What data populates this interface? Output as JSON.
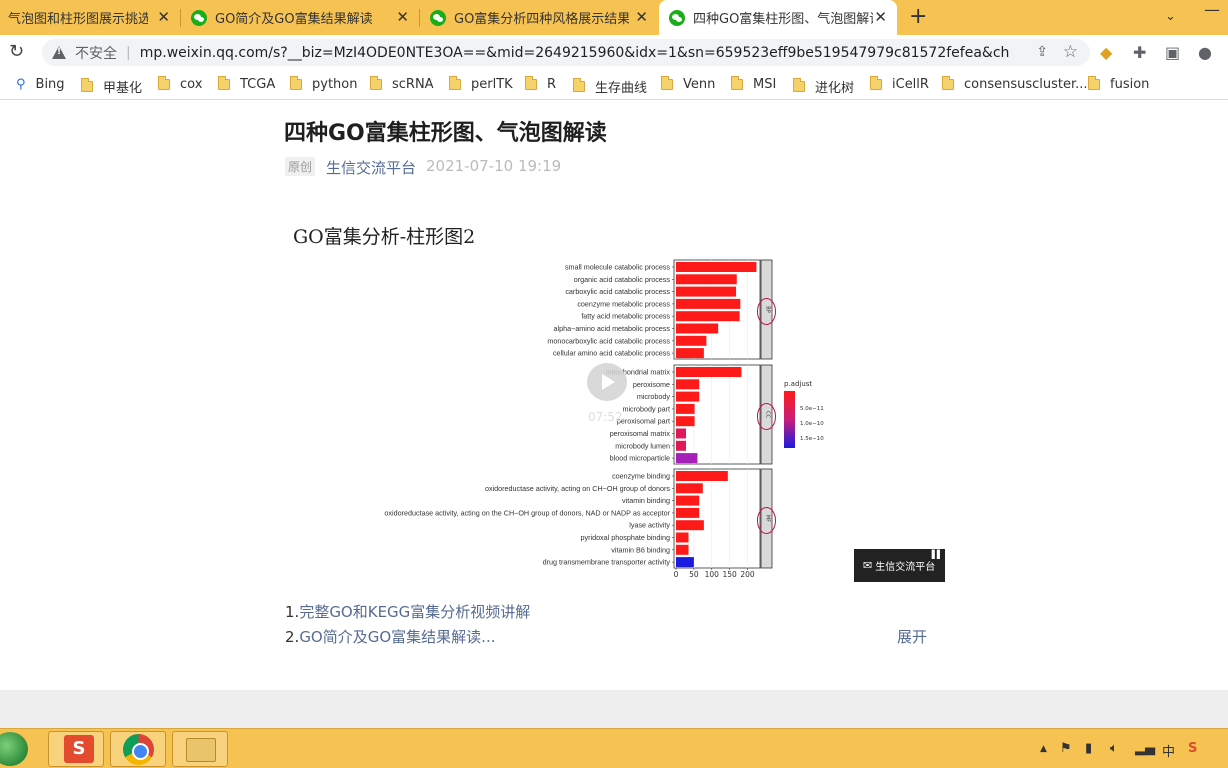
{
  "tabs": [
    {
      "title": "气泡图和柱形图展示挑选的"
    },
    {
      "title": "GO简介及GO富集结果解读"
    },
    {
      "title": "GO富集分析四种风格展示结果—"
    },
    {
      "title": "四种GO富集柱形图、气泡图解读"
    }
  ],
  "tab_close": "✕",
  "new_tab": "+",
  "tab_list": "⌄",
  "minimize": "—",
  "omnibox": {
    "insecure": "不安全",
    "sep": "|",
    "url": "mp.weixin.qq.com/s?__biz=MzI4ODE0NTE3OA==&mid=2649215960&idx=1&sn=659523eff9be519547979c81572fefea&chksm=f..."
  },
  "bookmarks": [
    "Bing",
    "甲基化",
    "cox",
    "TCGA",
    "python",
    "scRNA",
    "perlTK",
    "R",
    "生存曲线",
    "Venn",
    "MSI",
    "进化树",
    "iCellR",
    "consensuscluster...",
    "fusion"
  ],
  "article": {
    "title": "四种GO富集柱形图、气泡图解读",
    "badge": "原创",
    "author": "生信交流平台",
    "date": "2021-07-10 19:19",
    "video_heading": "GO富集分析-柱形图2",
    "video_time": "07:52",
    "watermark": "生信交流平台",
    "link1_num": "1.",
    "link1": "完整GO和KEGG富集分析视频讲解",
    "link2_num": "2.",
    "link2": "GO简介及GO富集结果解读...",
    "expand": "展开"
  },
  "chart_data": {
    "type": "bar",
    "orientation": "horizontal",
    "facets": [
      {
        "name": "BP",
        "categories": [
          "small molecule catabolic process",
          "organic acid catabolic process",
          "carboxylic acid catabolic process",
          "coenzyme metabolic process",
          "fatty acid metabolic process",
          "alpha−amino acid metabolic process",
          "monocarboxylic acid catabolic process",
          "cellular amino acid catabolic process"
        ],
        "values": [
          225,
          170,
          168,
          180,
          178,
          118,
          85,
          78
        ],
        "colors": [
          "#ff1a1a",
          "#ff1a1a",
          "#ff1a1a",
          "#ff1a1a",
          "#ff1a1a",
          "#ff1a1a",
          "#ff1a1a",
          "#ff1a1a"
        ]
      },
      {
        "name": "CC",
        "categories": [
          "mitochondrial matrix",
          "peroxisome",
          "microbody",
          "microbody part",
          "peroxisomal part",
          "peroxisomal matrix",
          "microbody lumen",
          "blood microparticle"
        ],
        "values": [
          183,
          65,
          65,
          52,
          52,
          28,
          28,
          60
        ],
        "colors": [
          "#ff1a1a",
          "#ff1a1a",
          "#ff1a1a",
          "#ff1a1a",
          "#ff1a1a",
          "#e0185a",
          "#e0185a",
          "#a51fb8"
        ]
      },
      {
        "name": "MF",
        "categories": [
          "coenzyme binding",
          "oxidoreductase activity, acting on CH−OH group of donors",
          "vitamin binding",
          "oxidoreductase activity, acting on the CH−OH group of donors, NAD or NADP as acceptor",
          "lyase activity",
          "pyridoxal phosphate binding",
          "vitamin B6 binding",
          "drug transmembrane transporter activity"
        ],
        "values": [
          145,
          75,
          65,
          65,
          78,
          35,
          35,
          50
        ],
        "colors": [
          "#ff1a1a",
          "#ff1a1a",
          "#ff1a1a",
          "#ff1a1a",
          "#ff1a1a",
          "#ff1a1a",
          "#ff1a1a",
          "#1a1ae0"
        ]
      }
    ],
    "x_ticks": [
      0,
      50,
      100,
      150,
      200
    ],
    "xlim": [
      0,
      235
    ],
    "legend": {
      "title": "p.adjust",
      "labels": [
        "5.0e−11",
        "1.0e−10",
        "1.5e−10"
      ],
      "colors": [
        "#ff1a1a",
        "#c81f7a",
        "#1a1ae0"
      ]
    }
  }
}
